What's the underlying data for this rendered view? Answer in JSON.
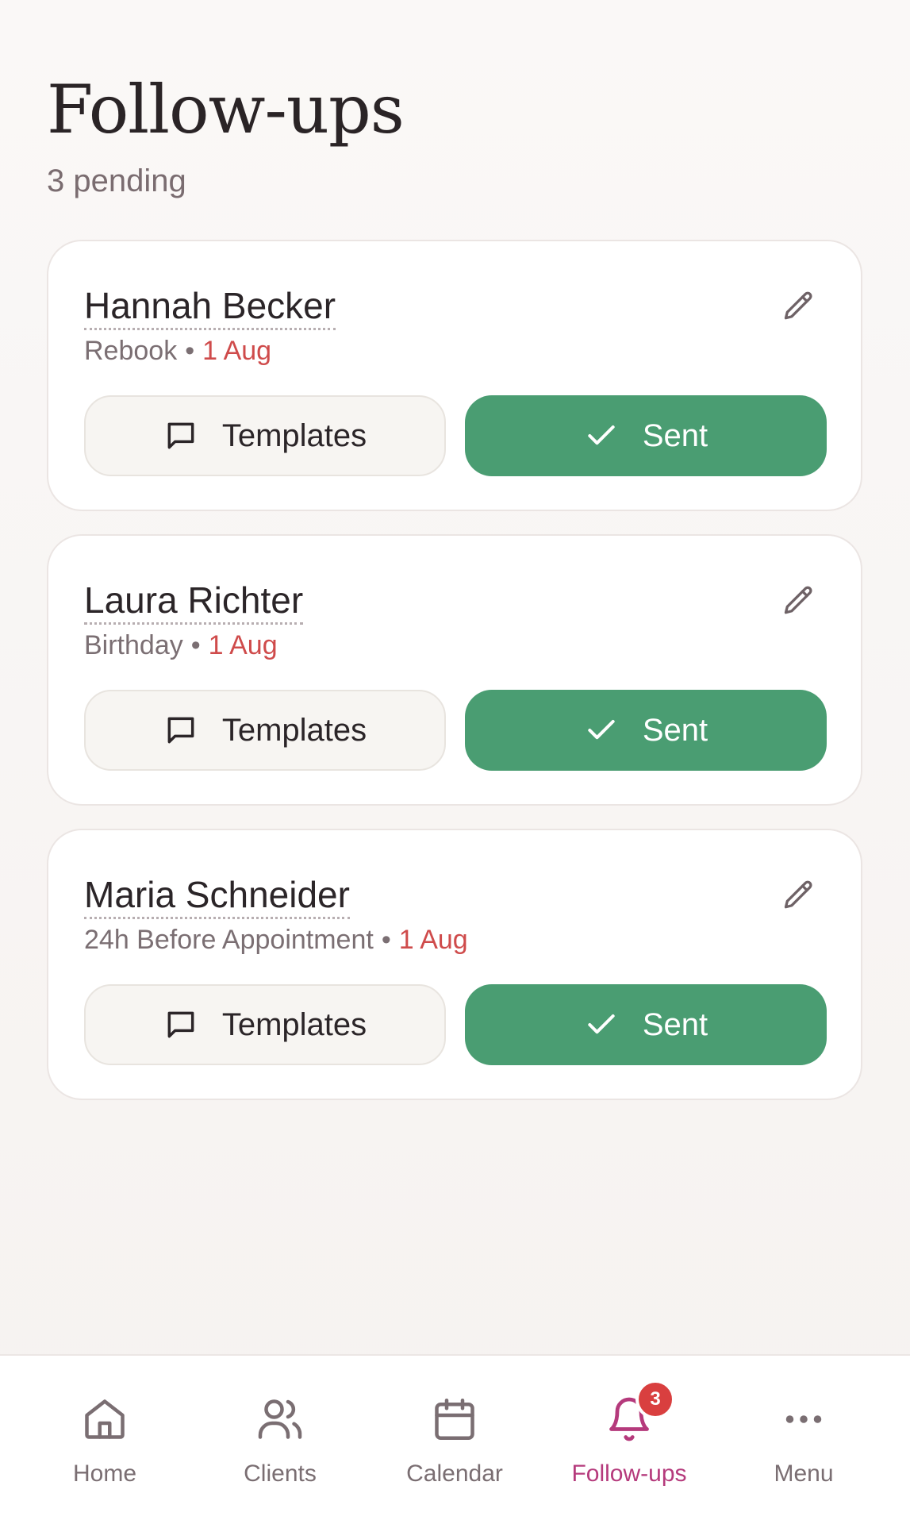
{
  "header": {
    "title": "Follow-ups",
    "subtitle": "3 pending"
  },
  "cards": [
    {
      "name": "Hannah Becker",
      "type": "Rebook",
      "separator": "•",
      "date": "1 Aug",
      "templates_label": "Templates",
      "sent_label": "Sent"
    },
    {
      "name": "Laura Richter",
      "type": "Birthday",
      "separator": "•",
      "date": "1 Aug",
      "templates_label": "Templates",
      "sent_label": "Sent"
    },
    {
      "name": "Maria Schneider",
      "type": "24h Before Appointment",
      "separator": "•",
      "date": "1 Aug",
      "templates_label": "Templates",
      "sent_label": "Sent"
    }
  ],
  "nav": {
    "items": [
      {
        "label": "Home",
        "icon": "home-icon"
      },
      {
        "label": "Clients",
        "icon": "users-icon"
      },
      {
        "label": "Calendar",
        "icon": "calendar-icon"
      },
      {
        "label": "Follow-ups",
        "icon": "bell-icon",
        "active": true,
        "badge": "3"
      },
      {
        "label": "Menu",
        "icon": "more-horizontal-icon"
      }
    ]
  },
  "colors": {
    "accent": "#b53a7c",
    "sent_button": "#4a9d72",
    "date": "#cf4b4b",
    "badge": "#d93f3f"
  }
}
